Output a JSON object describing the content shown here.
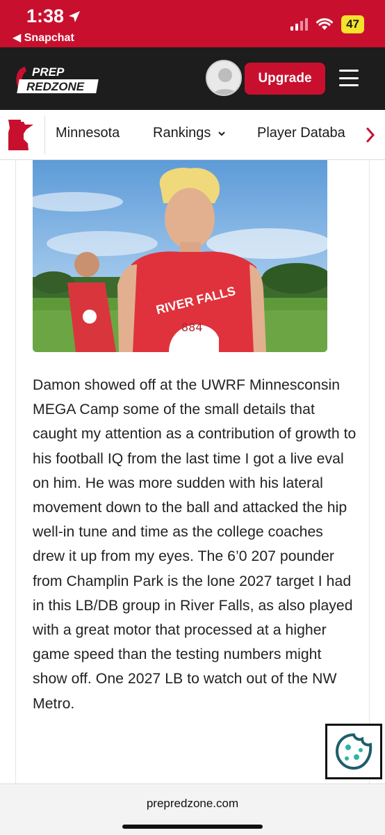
{
  "status_bar": {
    "time": "1:38",
    "back_app": "◀ Snapchat",
    "battery": "47"
  },
  "header": {
    "logo_line1": "PREP",
    "logo_line2": "REDZONE",
    "upgrade_label": "Upgrade"
  },
  "nav": {
    "items": [
      "Minnesota",
      "Rankings",
      "Player Databa"
    ]
  },
  "article": {
    "photo_jersey_text": "RIVER FALLS",
    "photo_number": "884",
    "body": "Damon showed off at the UWRF Minnesconsin MEGA Camp some of the small details that caught my attention as a contribution of growth to his football IQ from the last time I got a live eval on him. He was more sudden with his lateral movement down to the ball and attacked the hip well-in tune and time as the college coaches drew it up from my eyes. The 6’0 207 pounder from Champlin Park is the lone 2027 target I had in this LB/DB group in River Falls, as also played with a great motor that processed at a higher game speed than the testing numbers might show off. One 2027 LB to watch out of the NW Metro."
  },
  "browser": {
    "domain": "prepredzone.com"
  },
  "colors": {
    "brand_red": "#c8102e",
    "header_dark": "#1d1d1d",
    "cookie_teal": "#1e5e6a"
  }
}
